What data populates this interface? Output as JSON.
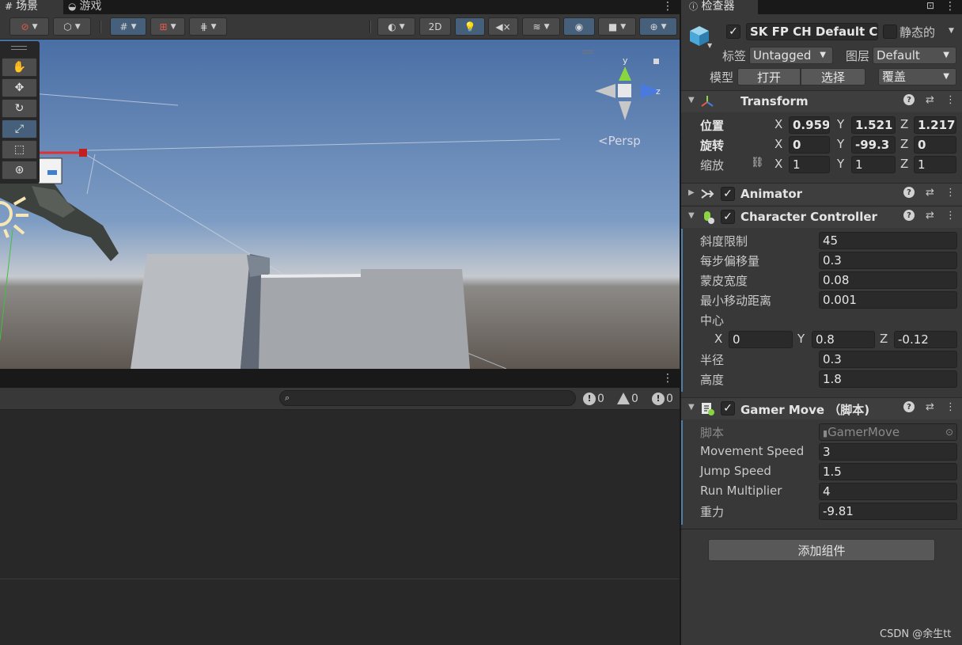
{
  "scene_panel": {
    "tabs": [
      {
        "label": "场景",
        "icon": "grid-icon"
      },
      {
        "label": "游戏",
        "icon": "gamepad-icon"
      }
    ],
    "toolbar": {
      "mode_2d": "2D"
    },
    "persp_label": "<Persp",
    "gizmo_axes": {
      "y": "y",
      "z": "z"
    }
  },
  "console_panel": {
    "search_placeholder": "",
    "counts": {
      "info": "0",
      "warning": "0",
      "error": "0"
    }
  },
  "inspector": {
    "tab_label": "检查器",
    "object": {
      "name": "SK FP CH Default Cu",
      "active_checked": true,
      "static_label": "静态的",
      "tag_label": "标签",
      "tag_value": "Untagged",
      "layer_label": "图层",
      "layer_value": "Default",
      "model_label": "模型",
      "open_button": "打开",
      "select_button": "选择",
      "override_value": "覆盖"
    },
    "transform": {
      "title": "Transform",
      "position_label": "位置",
      "rotation_label": "旋转",
      "scale_label": "缩放",
      "position": {
        "x": "0.959",
        "y": "1.521",
        "z": "1.217"
      },
      "rotation": {
        "x": "0",
        "y": "-99.3",
        "z": "0"
      },
      "scale": {
        "x": "1",
        "y": "1",
        "z": "1"
      },
      "axis_x": "X",
      "axis_y": "Y",
      "axis_z": "Z"
    },
    "animator": {
      "title": "Animator"
    },
    "character_controller": {
      "title": "Character Controller",
      "fields": [
        {
          "label": "斜度限制",
          "value": "45"
        },
        {
          "label": "每步偏移量",
          "value": "0.3"
        },
        {
          "label": "蒙皮宽度",
          "value": "0.08"
        },
        {
          "label": "最小移动距离",
          "value": "0.001"
        }
      ],
      "center_label": "中心",
      "center": {
        "x": "0",
        "y": "0.8",
        "z": "-0.12"
      },
      "radius_label": "半径",
      "radius_value": "0.3",
      "height_label": "高度",
      "height_value": "1.8"
    },
    "gamer_move": {
      "title": "Gamer Move （脚本)",
      "script_label": "脚本",
      "script_value": "GamerMove",
      "fields": [
        {
          "label": "Movement Speed",
          "value": "3"
        },
        {
          "label": "Jump Speed",
          "value": "1.5"
        },
        {
          "label": "Run Multiplier",
          "value": "4"
        },
        {
          "label": "重力",
          "value": "-9.81"
        }
      ]
    },
    "add_component": "添加组件",
    "watermark": "CSDN @余生tt"
  }
}
